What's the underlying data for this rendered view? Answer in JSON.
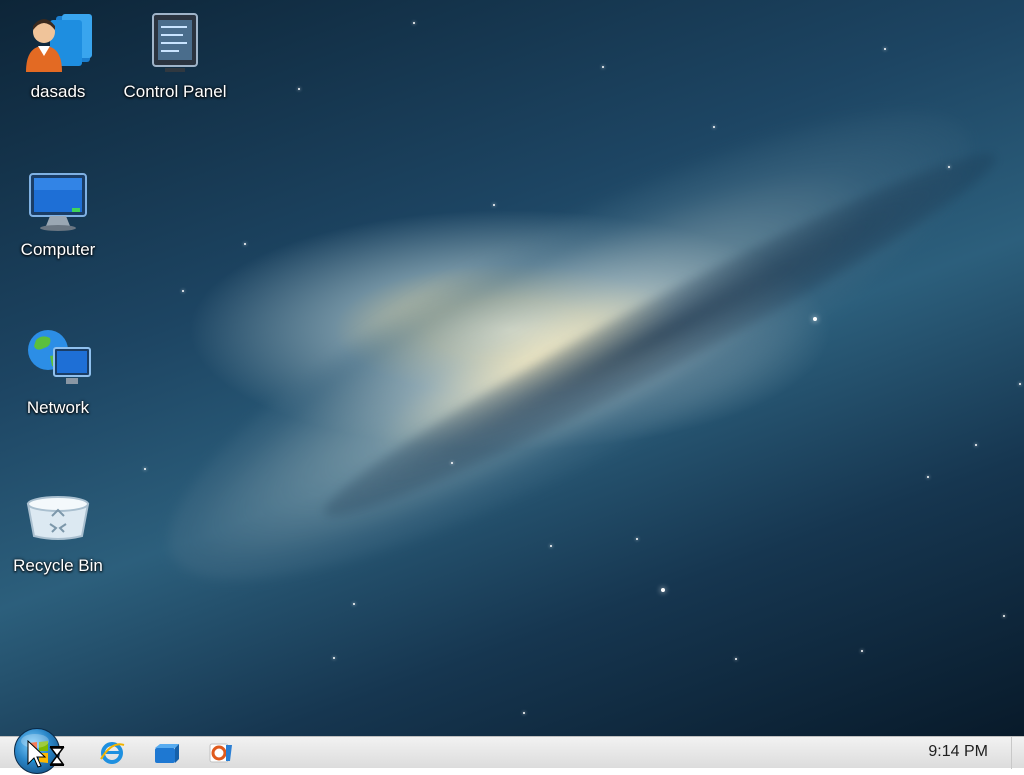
{
  "desktop": {
    "icons": [
      {
        "label": "dasads",
        "icon": "user-folder-icon"
      },
      {
        "label": "Control Panel",
        "icon": "control-panel-icon"
      },
      {
        "label": "Computer",
        "icon": "computer-monitor-icon"
      },
      {
        "label": "Network",
        "icon": "network-globe-icon"
      },
      {
        "label": "Recycle Bin",
        "icon": "recycle-bin-icon"
      }
    ]
  },
  "taskbar": {
    "start_icon": "start-orb-icon",
    "pinned": [
      {
        "icon": "internet-explorer-icon"
      },
      {
        "icon": "file-explorer-icon"
      },
      {
        "icon": "media-player-icon"
      }
    ],
    "clock": "9:14 PM"
  },
  "colors": {
    "taskbar_bg": "#e6e6e6",
    "label_text": "#ffffff",
    "clock_text": "#202020"
  }
}
